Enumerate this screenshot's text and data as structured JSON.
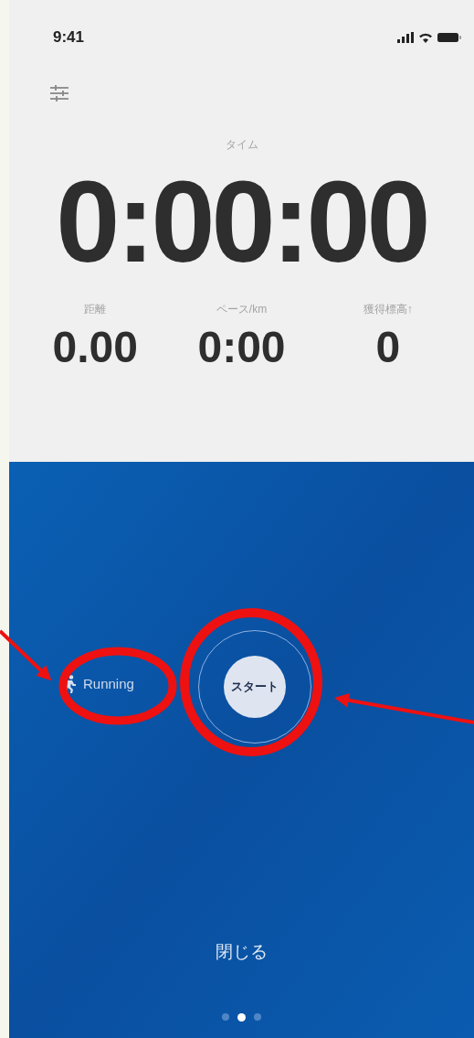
{
  "status_bar": {
    "time": "9:41"
  },
  "timer": {
    "label": "タイム",
    "value": "0:00:00"
  },
  "stats": [
    {
      "label": "距離",
      "value": "0.00"
    },
    {
      "label": "ペース/km",
      "value": "0:00"
    },
    {
      "label": "獲得標高↑",
      "value": "0"
    }
  ],
  "activity": {
    "label": "Running"
  },
  "start_button": {
    "label": "スタート"
  },
  "close_button": {
    "label": "閉じる"
  },
  "page_dots": [
    {
      "selected": false
    },
    {
      "selected": true
    },
    {
      "selected": false
    }
  ]
}
